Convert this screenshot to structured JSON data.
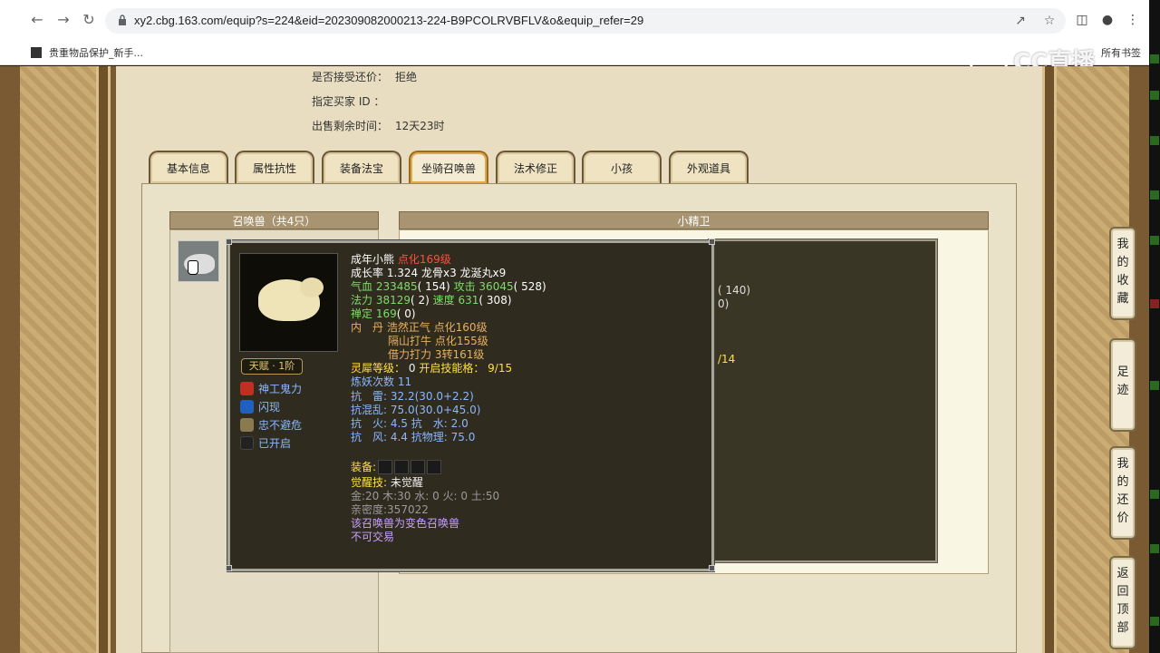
{
  "browser": {
    "url": "xy2.cbg.163.com/equip?s=224&eid=202309082000213-224-B9PCOLRVBFLV&o&equip_refer=29",
    "bookmark": "贵重物品保护_新手...",
    "bookmark_right": "所有书签"
  },
  "watermark": "CC直播",
  "info": [
    {
      "label": "是否接受还价：",
      "value": "拒绝"
    },
    {
      "label": "指定买家 ID ：",
      "value": ""
    },
    {
      "label": "出售剩余时间：",
      "value": "12天23时"
    }
  ],
  "tabs": [
    "基本信息",
    "属性抗性",
    "装备法宝",
    "坐骑召唤兽",
    "法术修正",
    "小孩",
    "外观道具"
  ],
  "active_tab": "坐骑召唤兽",
  "left_header": "召唤兽（共4只）",
  "right_header": "小精卫",
  "back_tooltip": {
    "lines": [
      "( 140)",
      "0)",
      "/14"
    ]
  },
  "tooltip": {
    "name": "成年小熊",
    "level": "点化169级",
    "growth": "成长率 1.324 龙骨x3 龙涎丸x9",
    "hp_label": "气血",
    "hp_value": "233485",
    "hp_extra": "( 154)",
    "atk_label": "攻击",
    "atk_value": "36045",
    "atk_extra": "( 528)",
    "mp_label": "法力",
    "mp_value": "38129",
    "mp_extra": "( 2)",
    "spd_label": "速度",
    "spd_value": "631",
    "spd_extra": "( 308)",
    "ding_label": "禅定",
    "ding_value": "169",
    "ding_extra": "( 0)",
    "nei_label": "内　丹",
    "nei_1": "浩然正气 点化160级",
    "nei_2": "隔山打牛 点化155级",
    "nei_3": "借力打力 3转161级",
    "lingxi_label": "灵犀等级：",
    "lingxi_value": "0",
    "skill_label": "开启技能格：",
    "skill_value": "9/15",
    "lianyao": "炼妖次数 11",
    "res_1": "抗　雷: 32.2(30.0+2.2)",
    "res_2": "抗混乱: 75.0(30.0+45.0)",
    "res_3": "抗　火: 4.5 抗　水: 2.0",
    "res_4": "抗　风: 4.4 抗物理: 75.0",
    "equip_label": "装备:",
    "awaken_label": "觉醒技:",
    "awaken_value": "未觉醒",
    "elements": "金:20 木:30 水: 0 火: 0 土:50",
    "intimacy": "亲密度:357022",
    "note1": "该召唤兽为变色召唤兽",
    "note2": "不可交易",
    "talent": "天赋 · 1阶",
    "skills": [
      "神工鬼力",
      "闪现",
      "忠不避危",
      "已开启"
    ]
  },
  "side_nav": [
    "我的收藏",
    "足迹",
    "我的还价",
    "返回顶部"
  ]
}
